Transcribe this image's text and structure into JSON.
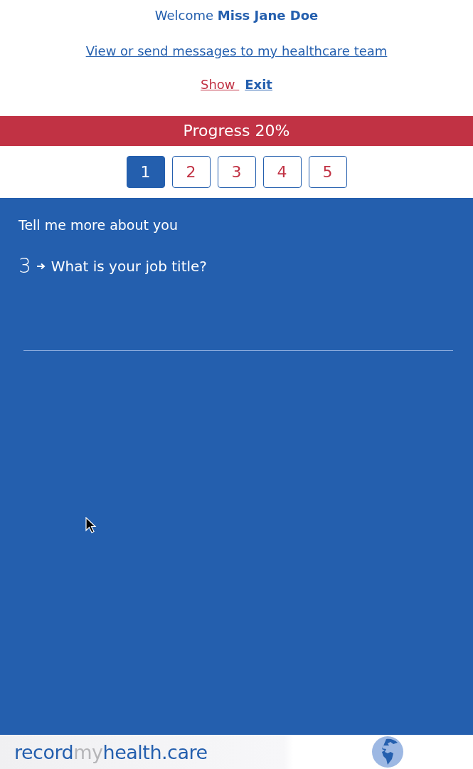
{
  "header": {
    "welcome": "Welcome **Miss Jane Doe**",
    "messages_link": "View or send messages to my healthcare team",
    "links": [
      {
        "label": "Show ",
        "kind": "show"
      },
      {
        "label": "Exit",
        "kind": "exit"
      }
    ]
  },
  "progress": {
    "label": "Progress 20%"
  },
  "pages": [
    {
      "label": "1",
      "selected": true
    },
    {
      "label": "2",
      "selected": false
    },
    {
      "label": "3",
      "selected": false
    },
    {
      "label": "4",
      "selected": false
    },
    {
      "label": "5",
      "selected": false
    }
  ],
  "form": {
    "section_title": "Tell me more about you",
    "question": {
      "number": "3",
      "text": "What is your job title?"
    }
  },
  "footer": {
    "logo": [
      {
        "text": "record",
        "kind": "main"
      },
      {
        "text": "my",
        "kind": "muted"
      },
      {
        "text": "health.care",
        "kind": "main"
      }
    ]
  }
}
